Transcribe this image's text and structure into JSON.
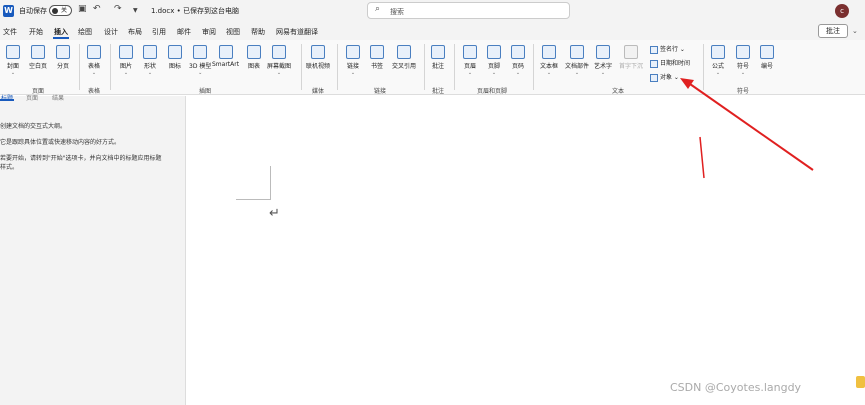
{
  "titlebar": {
    "autosave_label": "自动保存",
    "toggle_state": "关",
    "doc_title": "1.docx • 已保存到这台电脑",
    "search_placeholder": "搜索",
    "avatar_initial": "c"
  },
  "menu": {
    "tabs": [
      "文件",
      "开始",
      "插入",
      "绘图",
      "设计",
      "布局",
      "引用",
      "邮件",
      "审阅",
      "视图",
      "帮助",
      "网易有道翻译"
    ],
    "active_tab": "插入",
    "comment_button": "批注"
  },
  "ribbon": {
    "buttons": {
      "cover": "封面",
      "blank": "空白页",
      "pagebreak": "分页",
      "table": "表格",
      "picture": "图片",
      "shapes": "形状",
      "icons": "图标",
      "model3d": "3D 模型",
      "smartart": "SmartArt",
      "chart": "图表",
      "screenshot": "屏幕截图",
      "online_video": "联机视频",
      "link": "链接",
      "bookmark": "书签",
      "crossref": "交叉引用",
      "comment": "批注",
      "header": "页眉",
      "footer": "页脚",
      "pagenum": "页码",
      "textbox": "文本框",
      "quickparts": "文档部件",
      "wordart": "艺术字",
      "dropcap": "首字下沉",
      "signature": "签名行",
      "datetime": "日期和时间",
      "object": "对象",
      "equation": "公式",
      "symbol": "符号",
      "number": "编号"
    },
    "groups": {
      "pages": "页面",
      "tables": "表格",
      "illustrations": "插图",
      "media": "媒体",
      "links": "链接",
      "comments": "批注",
      "header_footer": "页眉和页脚",
      "text": "文本",
      "symbols": "符号"
    }
  },
  "navpane": {
    "tabs": [
      "标题",
      "页面",
      "结果"
    ],
    "lines": [
      "创建文档的交互式大纲。",
      "它是跟踪具体位置或快速移动内容的好方式。",
      "若要开始，请转到\"开始\"选项卡，并向文档中的标题应用标题",
      "样式。"
    ]
  },
  "document": {
    "paragraph_mark": "↵"
  },
  "watermark": "CSDN @Coyotes.langdy",
  "colors": {
    "accent": "#185abd",
    "arrow": "#e02020"
  }
}
